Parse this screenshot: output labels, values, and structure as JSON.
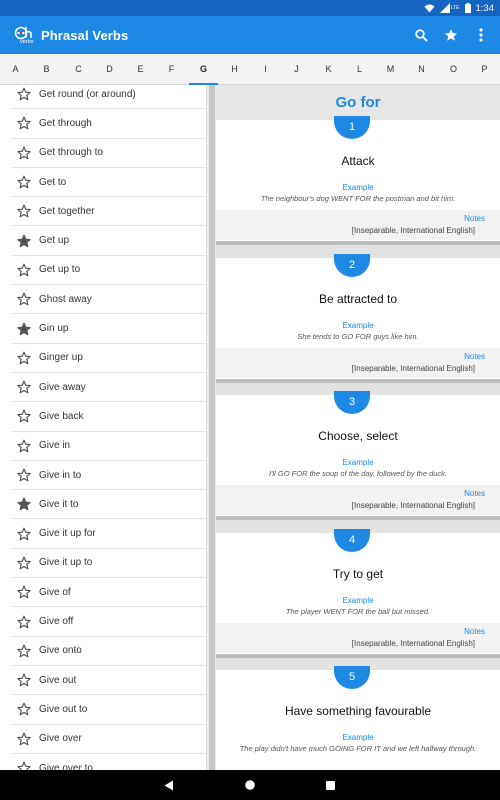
{
  "status_bar": {
    "time": "1:34",
    "network_badge": "LTE"
  },
  "app_bar": {
    "title": "Phrasal Verbs",
    "logo_text": "verbs"
  },
  "alphabet": [
    "A",
    "B",
    "C",
    "D",
    "E",
    "F",
    "G",
    "H",
    "I",
    "J",
    "K",
    "L",
    "M",
    "N",
    "O",
    "P"
  ],
  "alphabet_selected": "G",
  "verb_list": [
    {
      "label": "Get round (or around)",
      "starred": false
    },
    {
      "label": "Get through",
      "starred": false
    },
    {
      "label": "Get through to",
      "starred": false
    },
    {
      "label": "Get to",
      "starred": false
    },
    {
      "label": "Get together",
      "starred": false
    },
    {
      "label": "Get up",
      "starred": true
    },
    {
      "label": "Get up to",
      "starred": false
    },
    {
      "label": "Ghost away",
      "starred": false
    },
    {
      "label": "Gin up",
      "starred": true
    },
    {
      "label": "Ginger up",
      "starred": false
    },
    {
      "label": "Give away",
      "starred": false
    },
    {
      "label": "Give back",
      "starred": false
    },
    {
      "label": "Give in",
      "starred": false
    },
    {
      "label": "Give in to",
      "starred": false
    },
    {
      "label": "Give it to",
      "starred": true
    },
    {
      "label": "Give it up for",
      "starred": false
    },
    {
      "label": "Give it up to",
      "starred": false
    },
    {
      "label": "Give of",
      "starred": false
    },
    {
      "label": "Give off",
      "starred": false
    },
    {
      "label": "Give onto",
      "starred": false
    },
    {
      "label": "Give out",
      "starred": false
    },
    {
      "label": "Give out to",
      "starred": false
    },
    {
      "label": "Give over",
      "starred": false
    },
    {
      "label": "Give over to",
      "starred": false
    }
  ],
  "detail": {
    "title": "Go for",
    "example_label": "Example",
    "notes_label": "Notes",
    "meanings": [
      {
        "number": "1",
        "meaning": "Attack",
        "example": "The neighbour's dog WENT FOR the postman and bit him.",
        "notes": "[Inseparable, International English]"
      },
      {
        "number": "2",
        "meaning": "Be attracted to",
        "example": "She tends to GO FOR guys like him.",
        "notes": "[Inseparable, International English]"
      },
      {
        "number": "3",
        "meaning": "Choose, select",
        "example": "I'll GO FOR the soup of the day, followed by the duck.",
        "notes": "[Inseparable, International English]"
      },
      {
        "number": "4",
        "meaning": "Try to get",
        "example": "The player WENT FOR the ball but missed.",
        "notes": "[Inseparable, International English]"
      },
      {
        "number": "5",
        "meaning": "Have something favourable",
        "example": "The play didn't have much GOING FOR IT and we left halfway through.",
        "notes": ""
      }
    ]
  },
  "colors": {
    "primary": "#1e88e5",
    "status_bar": "#1565c0",
    "accent_text": "#1e88e5"
  },
  "icons": {
    "search": "search-icon",
    "favorites": "star-icon",
    "menu": "more-vert-icon"
  }
}
